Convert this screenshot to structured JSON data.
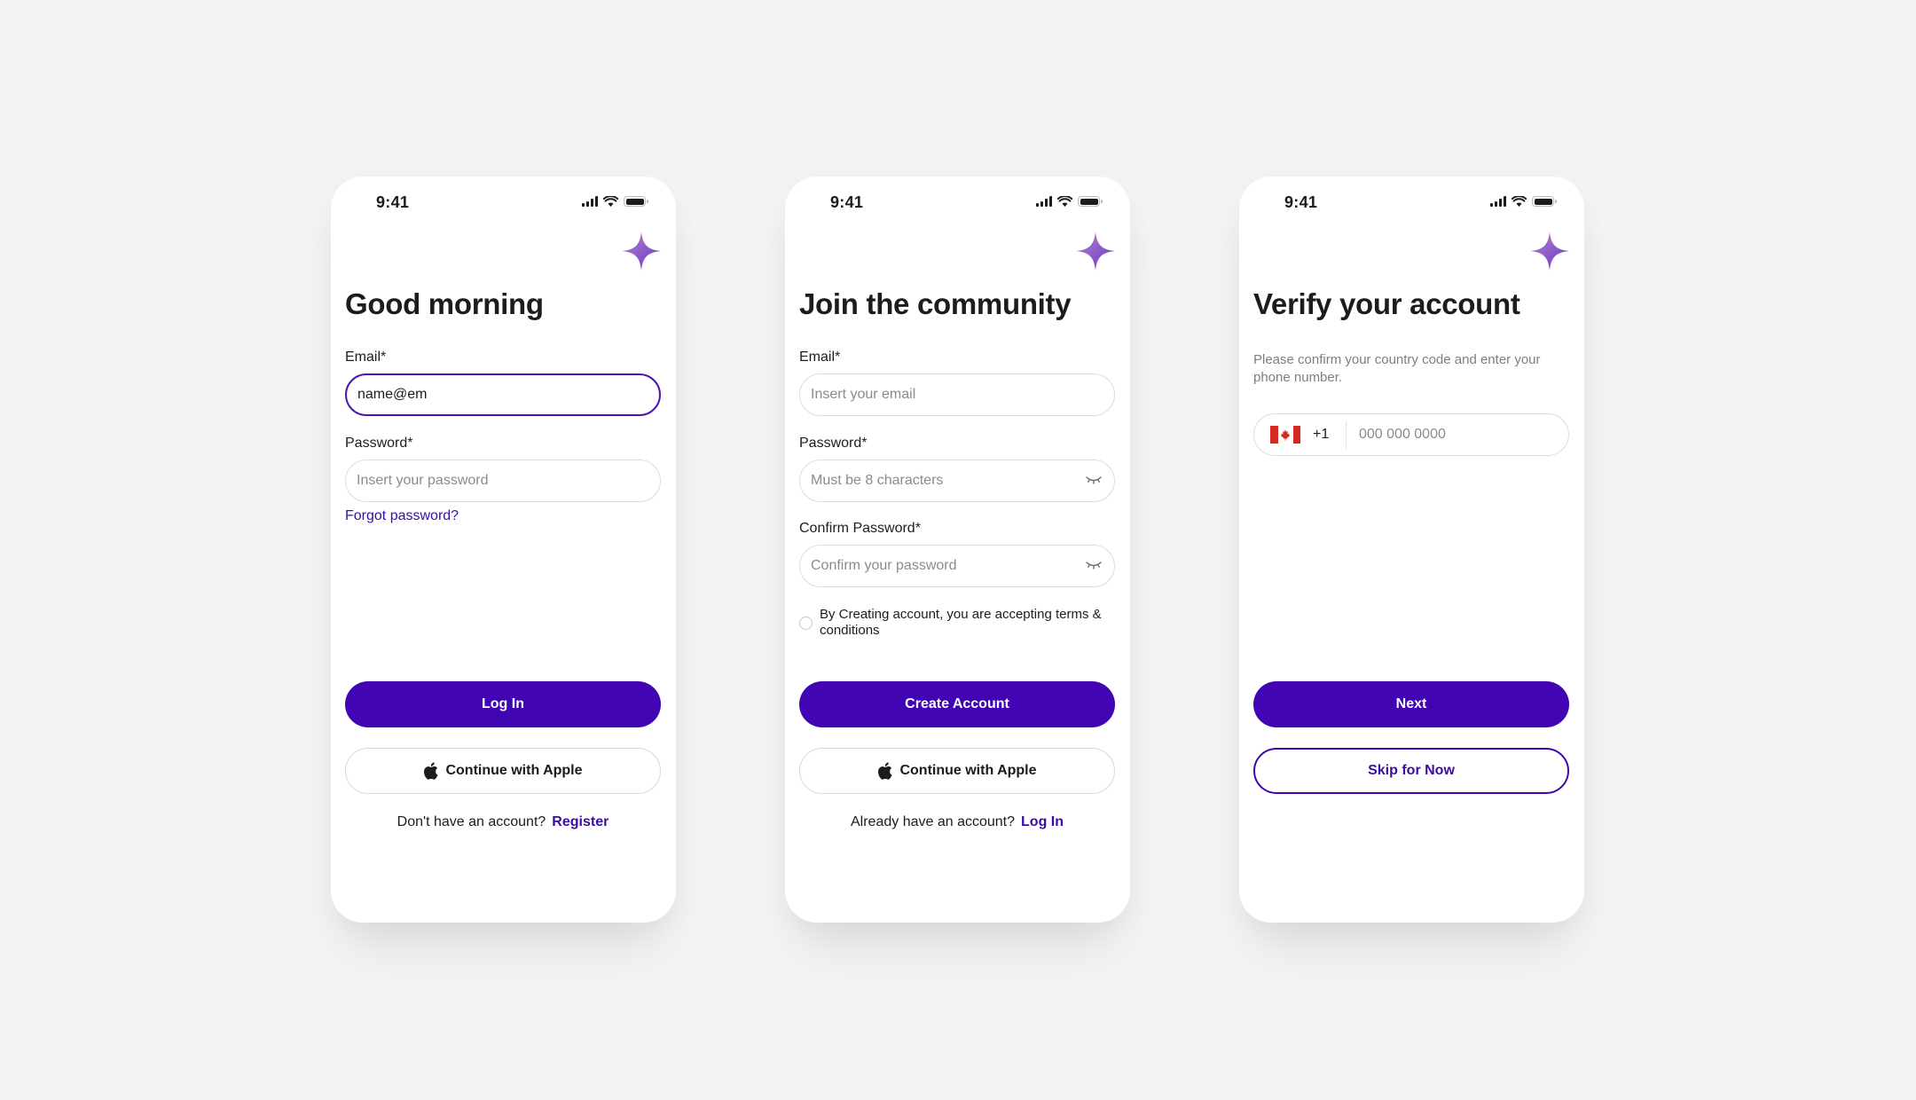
{
  "colors": {
    "accent": "#4105b3",
    "link": "#3a0ca3",
    "background": "#f3f3f3",
    "sparkle": "#8a5cc4"
  },
  "status_bar": {
    "time": "9:41"
  },
  "login": {
    "title": "Good morning",
    "email_label": "Email*",
    "email_value": "name@em",
    "password_label": "Password*",
    "password_placeholder": "Insert your password",
    "forgot_link": "Forgot password?",
    "primary_button": "Log In",
    "apple_button": "Continue with Apple",
    "footer_text": "Don't have an account?",
    "footer_link": "Register"
  },
  "register": {
    "title": "Join the community",
    "email_label": "Email*",
    "email_placeholder": "Insert your email",
    "password_label": "Password*",
    "password_placeholder": "Must be 8 characters",
    "confirm_label": "Confirm Password*",
    "confirm_placeholder": "Confirm your password",
    "terms_text": "By Creating account, you are accepting terms & conditions",
    "primary_button": "Create Account",
    "apple_button": "Continue with Apple",
    "footer_text": "Already have an account?",
    "footer_link": "Log In"
  },
  "verify": {
    "title": "Verify your account",
    "subtitle": "Please confirm your country code and enter your phone number.",
    "country_code": "+1",
    "country_flag": "canada-flag-icon",
    "phone_placeholder": "000 000 0000",
    "primary_button": "Next",
    "secondary_button": "Skip for Now"
  }
}
